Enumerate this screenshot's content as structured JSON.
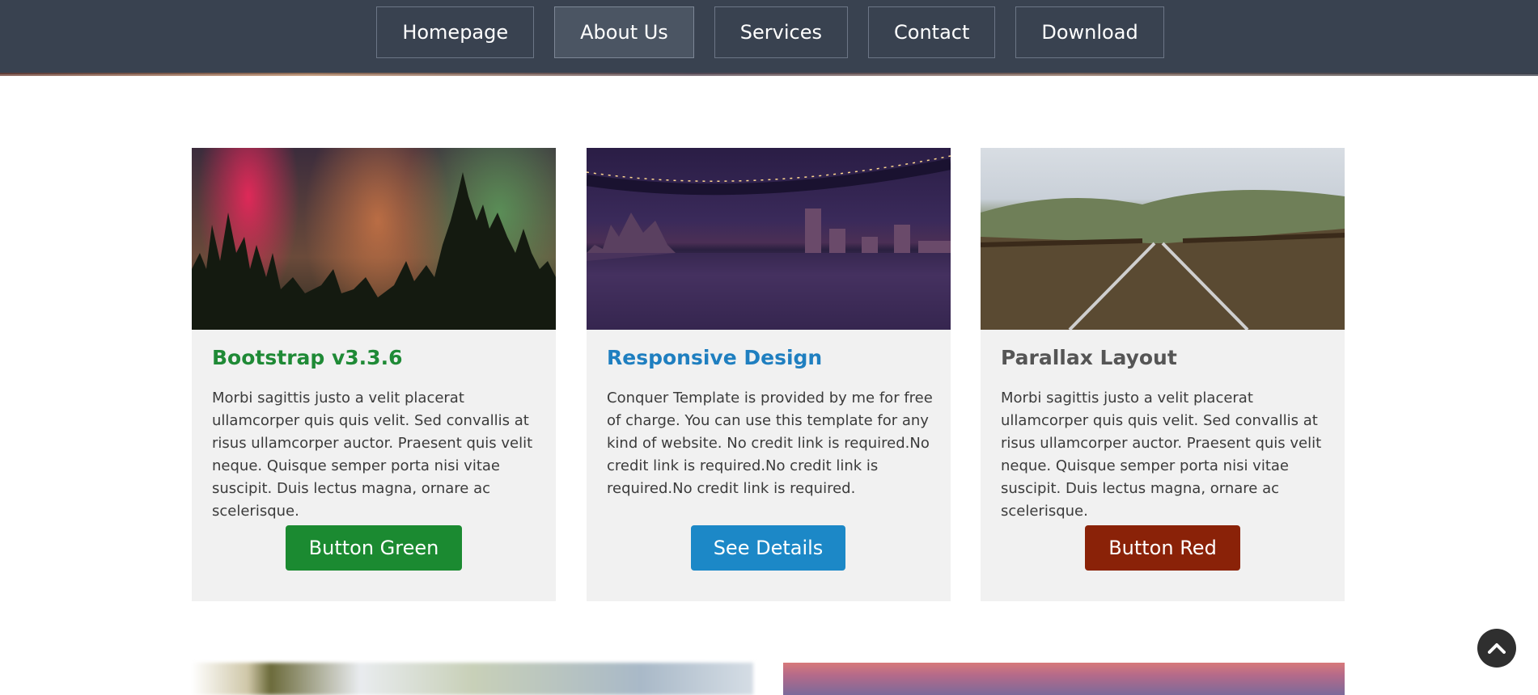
{
  "nav": {
    "items": [
      {
        "label": "Homepage",
        "active": false
      },
      {
        "label": "About Us",
        "active": true
      },
      {
        "label": "Services",
        "active": false
      },
      {
        "label": "Contact",
        "active": false
      },
      {
        "label": "Download",
        "active": false
      }
    ]
  },
  "cards": [
    {
      "title": "Bootstrap v3.3.6",
      "title_color": "#1f8a36",
      "text": "Morbi sagittis justo a velit placerat ullamcorper quis quis velit. Sed convallis at risus ullamcorper auctor. Praesent quis velit neque. Quisque semper porta nisi vitae suscipit. Duis lectus magna, ornare ac scelerisque.",
      "button": "Button Green",
      "button_color": "#1b8a31"
    },
    {
      "title": "Responsive Design",
      "title_color": "#1f7fc0",
      "text": "Conquer Template is provided by me for free of charge. You can use this template for any kind of website. No credit link is required.No credit link is required.No credit link is required.No credit link is required.",
      "button": "See Details",
      "button_color": "#1c88c7"
    },
    {
      "title": "Parallax Layout",
      "title_color": "#555555",
      "text": "Morbi sagittis justo a velit placerat ullamcorper quis quis velit. Sed convallis at risus ullamcorper auctor. Praesent quis velit neque. Quisque semper porta nisi vitae suscipit. Duis lectus magna, ornare ac scelerisque.",
      "button": "Button Red",
      "button_color": "#8a2208"
    }
  ],
  "icons": {
    "back_to_top": "chevron-up-icon"
  }
}
